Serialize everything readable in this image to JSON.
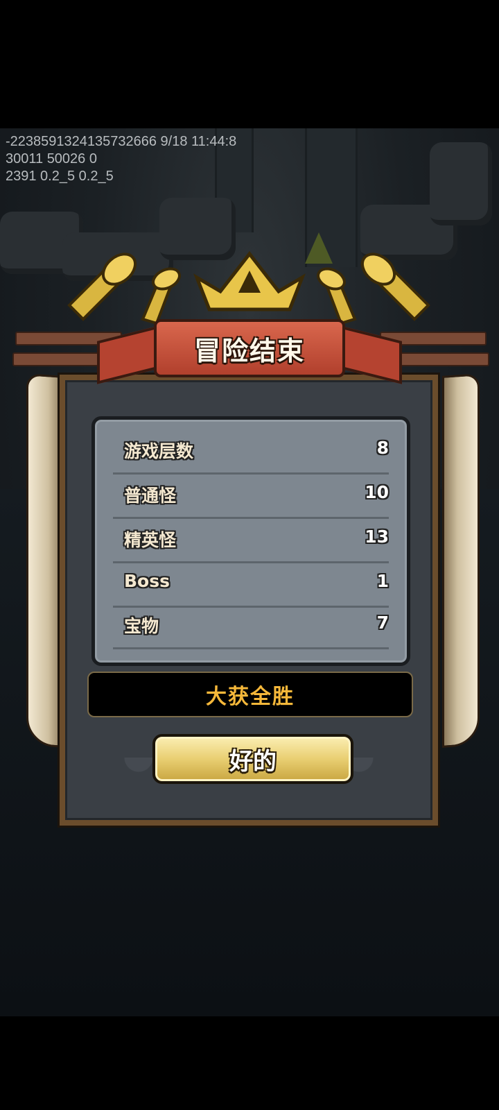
{
  "debug_lines": [
    "-2238591324135732666 9/18 11:44:8",
    "30011 50026 0",
    "2391 0.2_5 0.2_5"
  ],
  "dialog": {
    "title": "冒险结束",
    "stats": [
      {
        "label": "游戏层数",
        "value": "8"
      },
      {
        "label": "普通怪",
        "value": "10"
      },
      {
        "label": "精英怪",
        "value": "13"
      },
      {
        "label": "Boss",
        "value": "1"
      },
      {
        "label": "宝物",
        "value": "7"
      }
    ],
    "result": "大获全胜",
    "ok_label": "好的"
  },
  "colors": {
    "panel_bg": "#3a3f45",
    "stats_bg": "#7e8790",
    "result_text": "#f6b83a",
    "ribbon": "#c4503a",
    "button_gold": "#e9cf72"
  }
}
